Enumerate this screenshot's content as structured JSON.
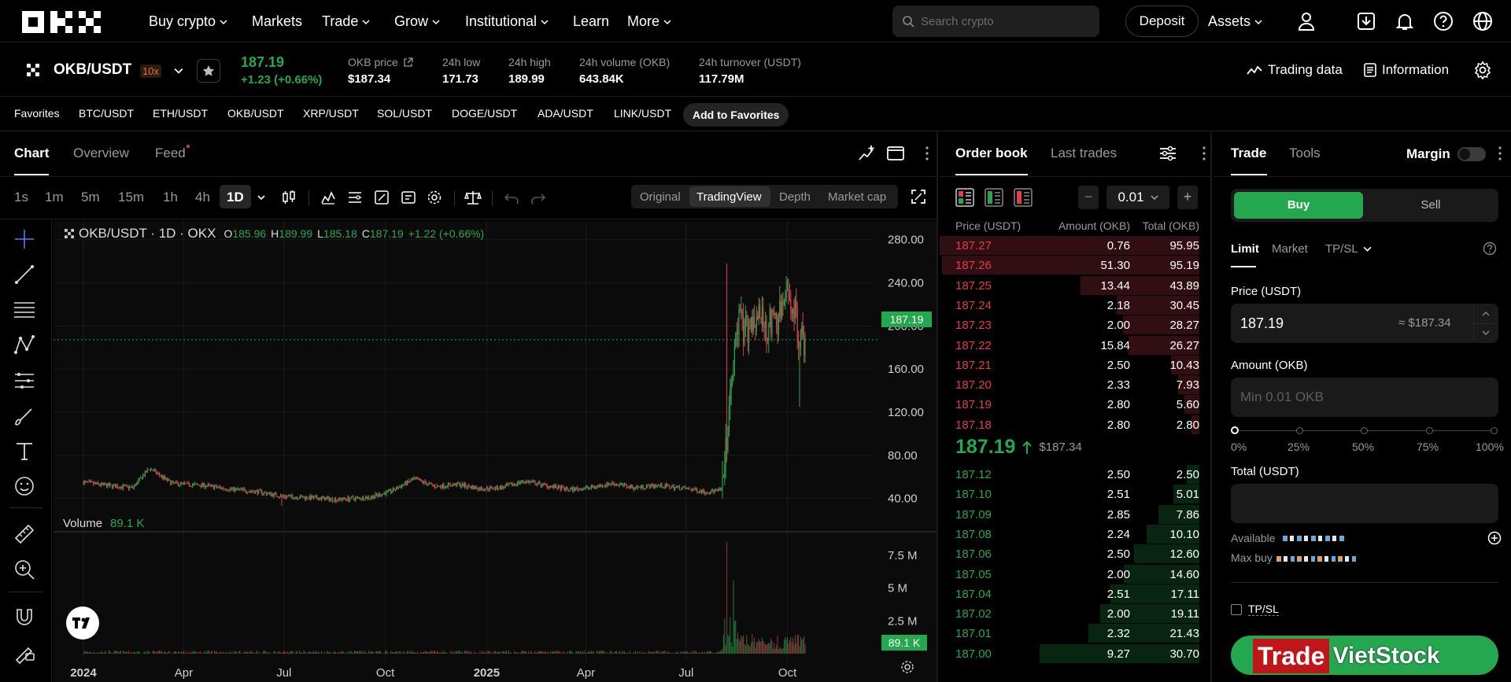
{
  "nav": {
    "items": [
      "Buy crypto",
      "Markets",
      "Trade",
      "Grow",
      "Institutional",
      "Learn",
      "More"
    ],
    "search_placeholder": "Search crypto",
    "deposit": "Deposit",
    "assets": "Assets"
  },
  "ticker": {
    "pair": "OKB/USDT",
    "leverage": "10x",
    "price": "187.19",
    "change": "+1.23 (+0.66%)",
    "stats": [
      {
        "label": "OKB price",
        "value": "$187.34"
      },
      {
        "label": "24h low",
        "value": "171.73"
      },
      {
        "label": "24h high",
        "value": "189.99"
      },
      {
        "label": "24h volume (OKB)",
        "value": "643.84K"
      },
      {
        "label": "24h turnover (USDT)",
        "value": "117.79M"
      }
    ],
    "trading_data": "Trading data",
    "information": "Information"
  },
  "favorites": {
    "label": "Favorites",
    "pairs": [
      "BTC/USDT",
      "ETH/USDT",
      "OKB/USDT",
      "XRP/USDT",
      "SOL/USDT",
      "DOGE/USDT",
      "ADA/USDT",
      "LINK/USDT"
    ],
    "add": "Add to Favorites"
  },
  "chart_panel": {
    "tabs": [
      "Chart",
      "Overview",
      "Feed"
    ],
    "timeframes": [
      "1s",
      "1m",
      "5m",
      "15m",
      "1h",
      "4h",
      "1D"
    ],
    "active_timeframe": "1D",
    "views": [
      "Original",
      "TradingView",
      "Depth",
      "Market cap"
    ],
    "active_view": "TradingView",
    "legend_title": "OKB/USDT · 1D · OKX",
    "ohlc": {
      "o_label": "O",
      "o": "185.96",
      "h_label": "H",
      "h": "189.99",
      "l_label": "L",
      "l": "185.18",
      "c_label": "C",
      "c": "187.19",
      "chg": "+1.22 (+0.66%)"
    },
    "volume_label": "Volume",
    "volume_value": "89.1 K",
    "last_price_tag": "187.19",
    "last_volume_tag": "89.1 K"
  },
  "chart_data": {
    "type": "candlestick",
    "price_ticks": [
      "280.00",
      "240.00",
      "200.00",
      "160.00",
      "120.00",
      "80.00",
      "40.00"
    ],
    "price_tick_values": [
      280,
      240,
      200,
      160,
      120,
      80,
      40
    ],
    "volume_ticks": [
      "7.5 M",
      "5 M",
      "2.5 M"
    ],
    "volume_tick_values": [
      7.5,
      5,
      2.5
    ],
    "x_ticks": [
      "2024",
      "Apr",
      "Jul",
      "Oct",
      "2025",
      "Apr",
      "Jul",
      "Oct"
    ],
    "x_tick_days": [
      0,
      91,
      182,
      274,
      366,
      456,
      547,
      639
    ],
    "ylim": [
      20,
      290
    ],
    "close_series_days": [
      0,
      20,
      45,
      60,
      80,
      110,
      130,
      160,
      180,
      200,
      230,
      260,
      280,
      300,
      320,
      340,
      360,
      380,
      400,
      420,
      440,
      460,
      480,
      500,
      520,
      540,
      555,
      565,
      575,
      580,
      585,
      590,
      595,
      600,
      610,
      620,
      630,
      640,
      645,
      650,
      655
    ],
    "close_series_values": [
      55,
      52,
      50,
      68,
      54,
      52,
      49,
      46,
      42,
      41,
      39,
      41,
      47,
      58,
      51,
      53,
      49,
      50,
      56,
      52,
      48,
      50,
      54,
      50,
      52,
      50,
      48,
      46,
      47,
      48,
      110,
      160,
      205,
      195,
      210,
      200,
      205,
      230,
      215,
      190,
      187
    ],
    "spike_high": 258,
    "spike_low": 125
  },
  "orderbook": {
    "tabs": [
      "Order book",
      "Last trades"
    ],
    "tick_size": "0.01",
    "headers": [
      "Price (USDT)",
      "Amount (OKB)",
      "Total (OKB)"
    ],
    "asks": [
      [
        "187.27",
        "0.76",
        "95.95"
      ],
      [
        "187.26",
        "51.30",
        "95.19"
      ],
      [
        "187.25",
        "13.44",
        "43.89"
      ],
      [
        "187.24",
        "2.18",
        "30.45"
      ],
      [
        "187.23",
        "2.00",
        "28.27"
      ],
      [
        "187.22",
        "15.84",
        "26.27"
      ],
      [
        "187.21",
        "2.50",
        "10.43"
      ],
      [
        "187.20",
        "2.33",
        "7.93"
      ],
      [
        "187.19",
        "2.80",
        "5.60"
      ],
      [
        "187.18",
        "2.80",
        "2.80"
      ]
    ],
    "mid_price": "187.19",
    "mid_fiat": "$187.34",
    "bids": [
      [
        "187.12",
        "2.50",
        "2.50"
      ],
      [
        "187.10",
        "2.51",
        "5.01"
      ],
      [
        "187.09",
        "2.85",
        "7.86"
      ],
      [
        "187.08",
        "2.24",
        "10.10"
      ],
      [
        "187.06",
        "2.50",
        "12.60"
      ],
      [
        "187.05",
        "2.00",
        "14.60"
      ],
      [
        "187.04",
        "2.51",
        "17.11"
      ],
      [
        "187.02",
        "2.00",
        "19.11"
      ],
      [
        "187.01",
        "2.32",
        "21.43"
      ],
      [
        "187.00",
        "9.27",
        "30.70"
      ]
    ]
  },
  "trade": {
    "tabs": [
      "Trade",
      "Tools"
    ],
    "margin": "Margin",
    "buy": "Buy",
    "sell": "Sell",
    "order_types": [
      "Limit",
      "Market",
      "TP/SL"
    ],
    "price_label": "Price (USDT)",
    "price_value": "187.19",
    "price_fiat": "≈ $187.34",
    "amount_label": "Amount (OKB)",
    "amount_placeholder": "Min 0.01 OKB",
    "slider_marks": [
      "0%",
      "25%",
      "50%",
      "75%",
      "100%"
    ],
    "total_label": "Total (USDT)",
    "available_label": "Available",
    "maxbuy_label": "Max buy",
    "tpsl_label": "TP/SL",
    "watermark": {
      "part1": "Trade",
      "part2": "VietStock"
    }
  },
  "colors": {
    "green": "#25a750",
    "red": "#e03e4f",
    "bg": "#000000"
  }
}
